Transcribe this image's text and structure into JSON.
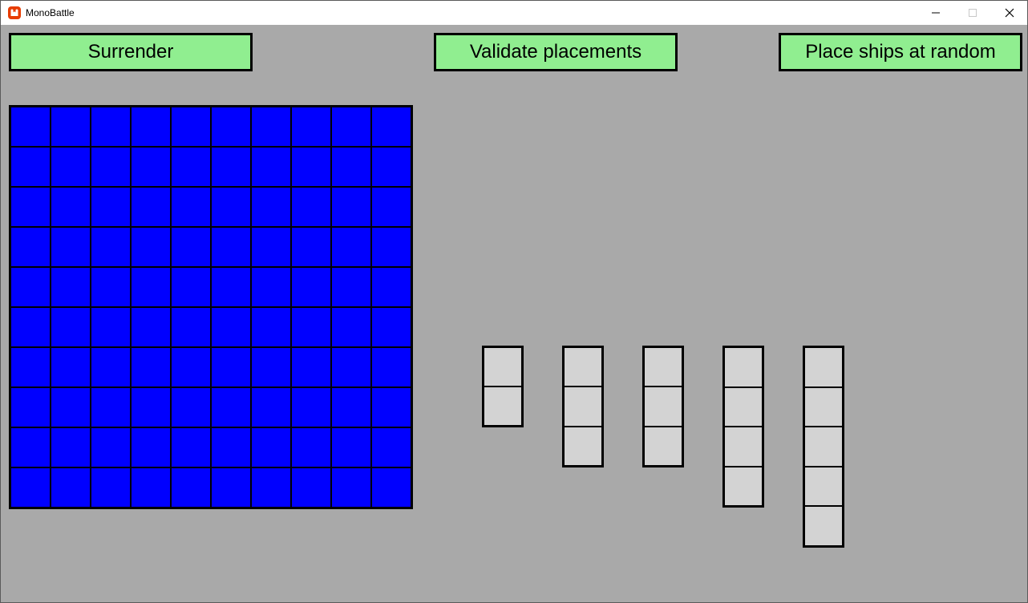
{
  "window": {
    "title": "MonoBattle",
    "controls": {
      "minimize_icon": "minimize-icon",
      "maximize_icon": "maximize-icon",
      "close_icon": "close-icon"
    }
  },
  "toolbar": {
    "surrender_label": "Surrender",
    "validate_label": "Validate placements",
    "random_label": "Place ships at random"
  },
  "board": {
    "rows": 10,
    "cols": 10,
    "cell_color": "#0000ff",
    "line_color": "#000000"
  },
  "ships": [
    {
      "length": 2
    },
    {
      "length": 3
    },
    {
      "length": 3
    },
    {
      "length": 4
    },
    {
      "length": 5
    }
  ],
  "colors": {
    "background": "#a9a9a9",
    "button": "#90ee90",
    "ship": "#d3d3d3"
  }
}
